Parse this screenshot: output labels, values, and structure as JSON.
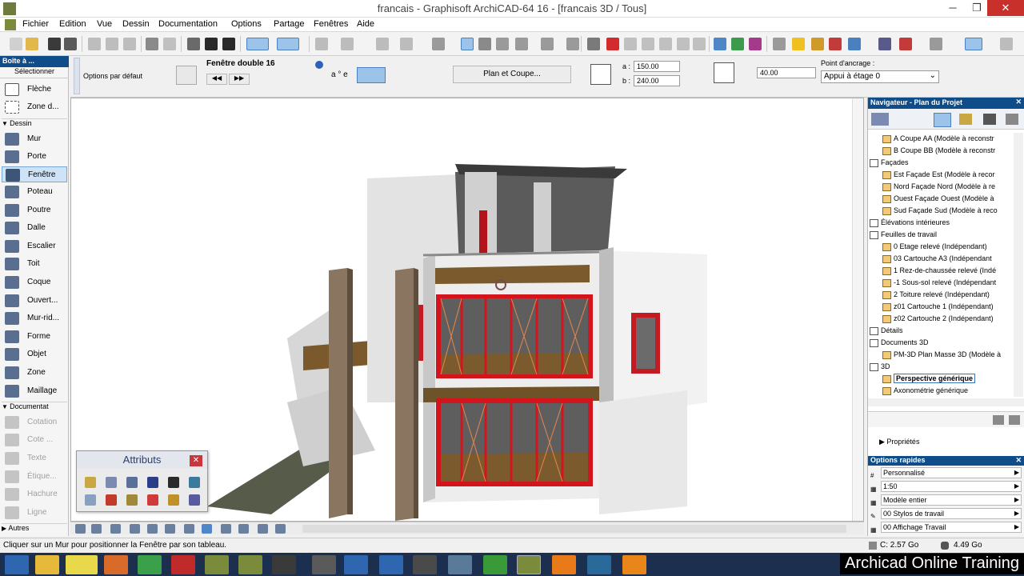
{
  "window": {
    "title": "francais - Graphisoft ArchiCAD-64 16 - [francais 3D / Tous]",
    "min": "─",
    "max": "❐",
    "close": "✕"
  },
  "menu": [
    "Fichier",
    "Edition",
    "Vue",
    "Dessin",
    "Documentation",
    "Options",
    "Partage",
    "Fenêtres",
    "Aide"
  ],
  "infobox": {
    "default_options": "Options par défaut",
    "element_name": "Fenêtre double 16",
    "prev": "◀◀",
    "next": "▶▶",
    "plan_coupe": "Plan et Coupe...",
    "a_label": "a :",
    "a_value": "150.00",
    "b_label": "b :",
    "b_value": "240.00",
    "height_value": "40.00",
    "anchor_label": "Point d'ancrage :",
    "anchor_value": "Appui à étage 0"
  },
  "toolbox": {
    "title": "Boîte à ...",
    "select": "Sélectionner",
    "arrow": "Flèche",
    "marquee": "Zone d...",
    "sect_dessin": "Dessin",
    "tools": [
      "Mur",
      "Porte",
      "Fenêtre",
      "Poteau",
      "Poutre",
      "Dalle",
      "Escalier",
      "Toit",
      "Coque",
      "Ouvert...",
      "Mur-rid...",
      "Forme",
      "Objet",
      "Zone",
      "Maillage"
    ],
    "selected_tool": "Fenêtre",
    "sect_doc": "Documentat",
    "doc_tools": [
      "Cotation",
      "Cote ...",
      "Texte",
      "Étique...",
      "Hachure",
      "Ligne"
    ],
    "sect_autres": "Autres"
  },
  "attributs": {
    "title": "Attributs",
    "close": "✕"
  },
  "navigator": {
    "title": "Navigateur - Plan du Projet",
    "items": [
      {
        "label": "A Coupe AA (Modèle à reconstr",
        "level": 2,
        "cat": false
      },
      {
        "label": "B Coupe BB (Modèle à reconstr",
        "level": 2,
        "cat": false
      },
      {
        "label": "Façades",
        "level": 1,
        "cat": true
      },
      {
        "label": "Est Façade Est (Modèle à recor",
        "level": 2,
        "cat": false
      },
      {
        "label": "Nord Façade Nord (Modèle à re",
        "level": 2,
        "cat": false
      },
      {
        "label": "Ouest Façade Ouest (Modèle à",
        "level": 2,
        "cat": false
      },
      {
        "label": "Sud Façade Sud (Modèle à reco",
        "level": 2,
        "cat": false
      },
      {
        "label": "Élévations intérieures",
        "level": 1,
        "cat": true
      },
      {
        "label": "Feuilles de travail",
        "level": 1,
        "cat": true
      },
      {
        "label": "0 Etage relevé (Indépendant)",
        "level": 2,
        "cat": false
      },
      {
        "label": "03 Cartouche A3 (Indépendant",
        "level": 2,
        "cat": false
      },
      {
        "label": "1 Rez-de-chaussée relevé (Indé",
        "level": 2,
        "cat": false
      },
      {
        "label": "-1 Sous-sol relevé (Indépendant",
        "level": 2,
        "cat": false
      },
      {
        "label": "2 Toiture relevé (Indépendant)",
        "level": 2,
        "cat": false
      },
      {
        "label": "z01 Cartouche 1 (Indépendant)",
        "level": 2,
        "cat": false
      },
      {
        "label": "z02 Cartouche 2 (Indépendant)",
        "level": 2,
        "cat": false
      },
      {
        "label": "Détails",
        "level": 1,
        "cat": true
      },
      {
        "label": "Documents 3D",
        "level": 1,
        "cat": true
      },
      {
        "label": "PM-3D Plan Masse 3D (Modèle à",
        "level": 2,
        "cat": false
      },
      {
        "label": "3D",
        "level": 1,
        "cat": true
      },
      {
        "label": "Perspective générique",
        "level": 2,
        "cat": false
      },
      {
        "label": "Axonométrie générique",
        "level": 2,
        "cat": false
      }
    ],
    "selected": "Perspective générique",
    "properties": "Propriétés"
  },
  "options_rapides": {
    "title": "Options rapides",
    "rows": [
      "Personnalisé",
      "1:50",
      "Modèle entier",
      "00 Stylos de travail",
      "00 Affichage Travail"
    ]
  },
  "status": {
    "hint": "Cliquer sur un Mur pour positionner la Fenêtre par son tableau.",
    "disk_c": "C: 2.57 Go",
    "mem": "4.49 Go"
  },
  "watermark": "Archicad Online Training",
  "colors": {
    "panel_header": "#0f4c8a",
    "window_frame": "#d4141c",
    "taskbar": "#1d2f4f"
  }
}
